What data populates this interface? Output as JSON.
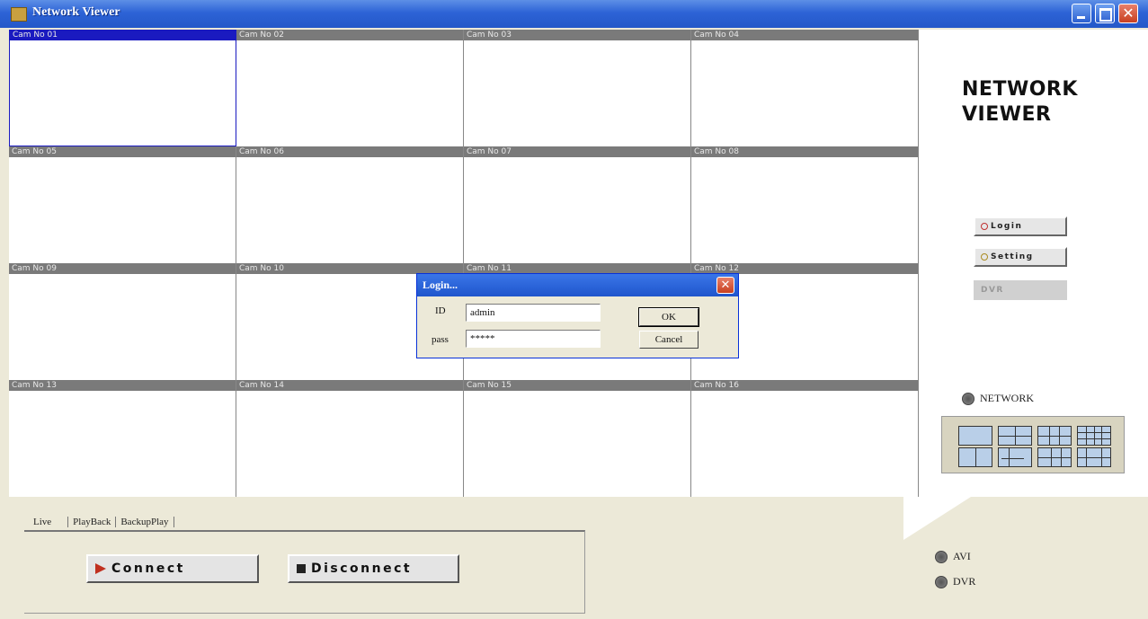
{
  "window": {
    "title": "Network Viewer"
  },
  "cameras": [
    "Cam No 01",
    "Cam No 02",
    "Cam No 03",
    "Cam No 04",
    "Cam No 05",
    "Cam No 06",
    "Cam No 07",
    "Cam No 08",
    "Cam No 09",
    "Cam No 10",
    "Cam No 11",
    "Cam No 12",
    "Cam No 13",
    "Cam No 14",
    "Cam No 15",
    "Cam No 16"
  ],
  "side": {
    "logo_line1": "NETWORK",
    "logo_line2": "VIEWER",
    "login_label": "Login",
    "setting_label": "Setting",
    "dvr_button_label": "DVR",
    "network_label": "NETWORK"
  },
  "tabs": {
    "live": "Live",
    "playback": "PlayBack",
    "backupplay": "BackupPlay"
  },
  "buttons": {
    "connect": "Connect",
    "disconnect": "Disconnect"
  },
  "bottom_radios": {
    "avi": "AVI",
    "dvr": "DVR"
  },
  "login_dialog": {
    "title": "Login...",
    "id_label": "ID",
    "id_value": "admin",
    "pass_label": "pass",
    "pass_value": "*****",
    "ok_label": "OK",
    "cancel_label": "Cancel"
  },
  "colors": {
    "title_bar": "#2458c8",
    "selected_cam": "#1a1ac0",
    "cam_label_bar": "#7a7a7a"
  }
}
